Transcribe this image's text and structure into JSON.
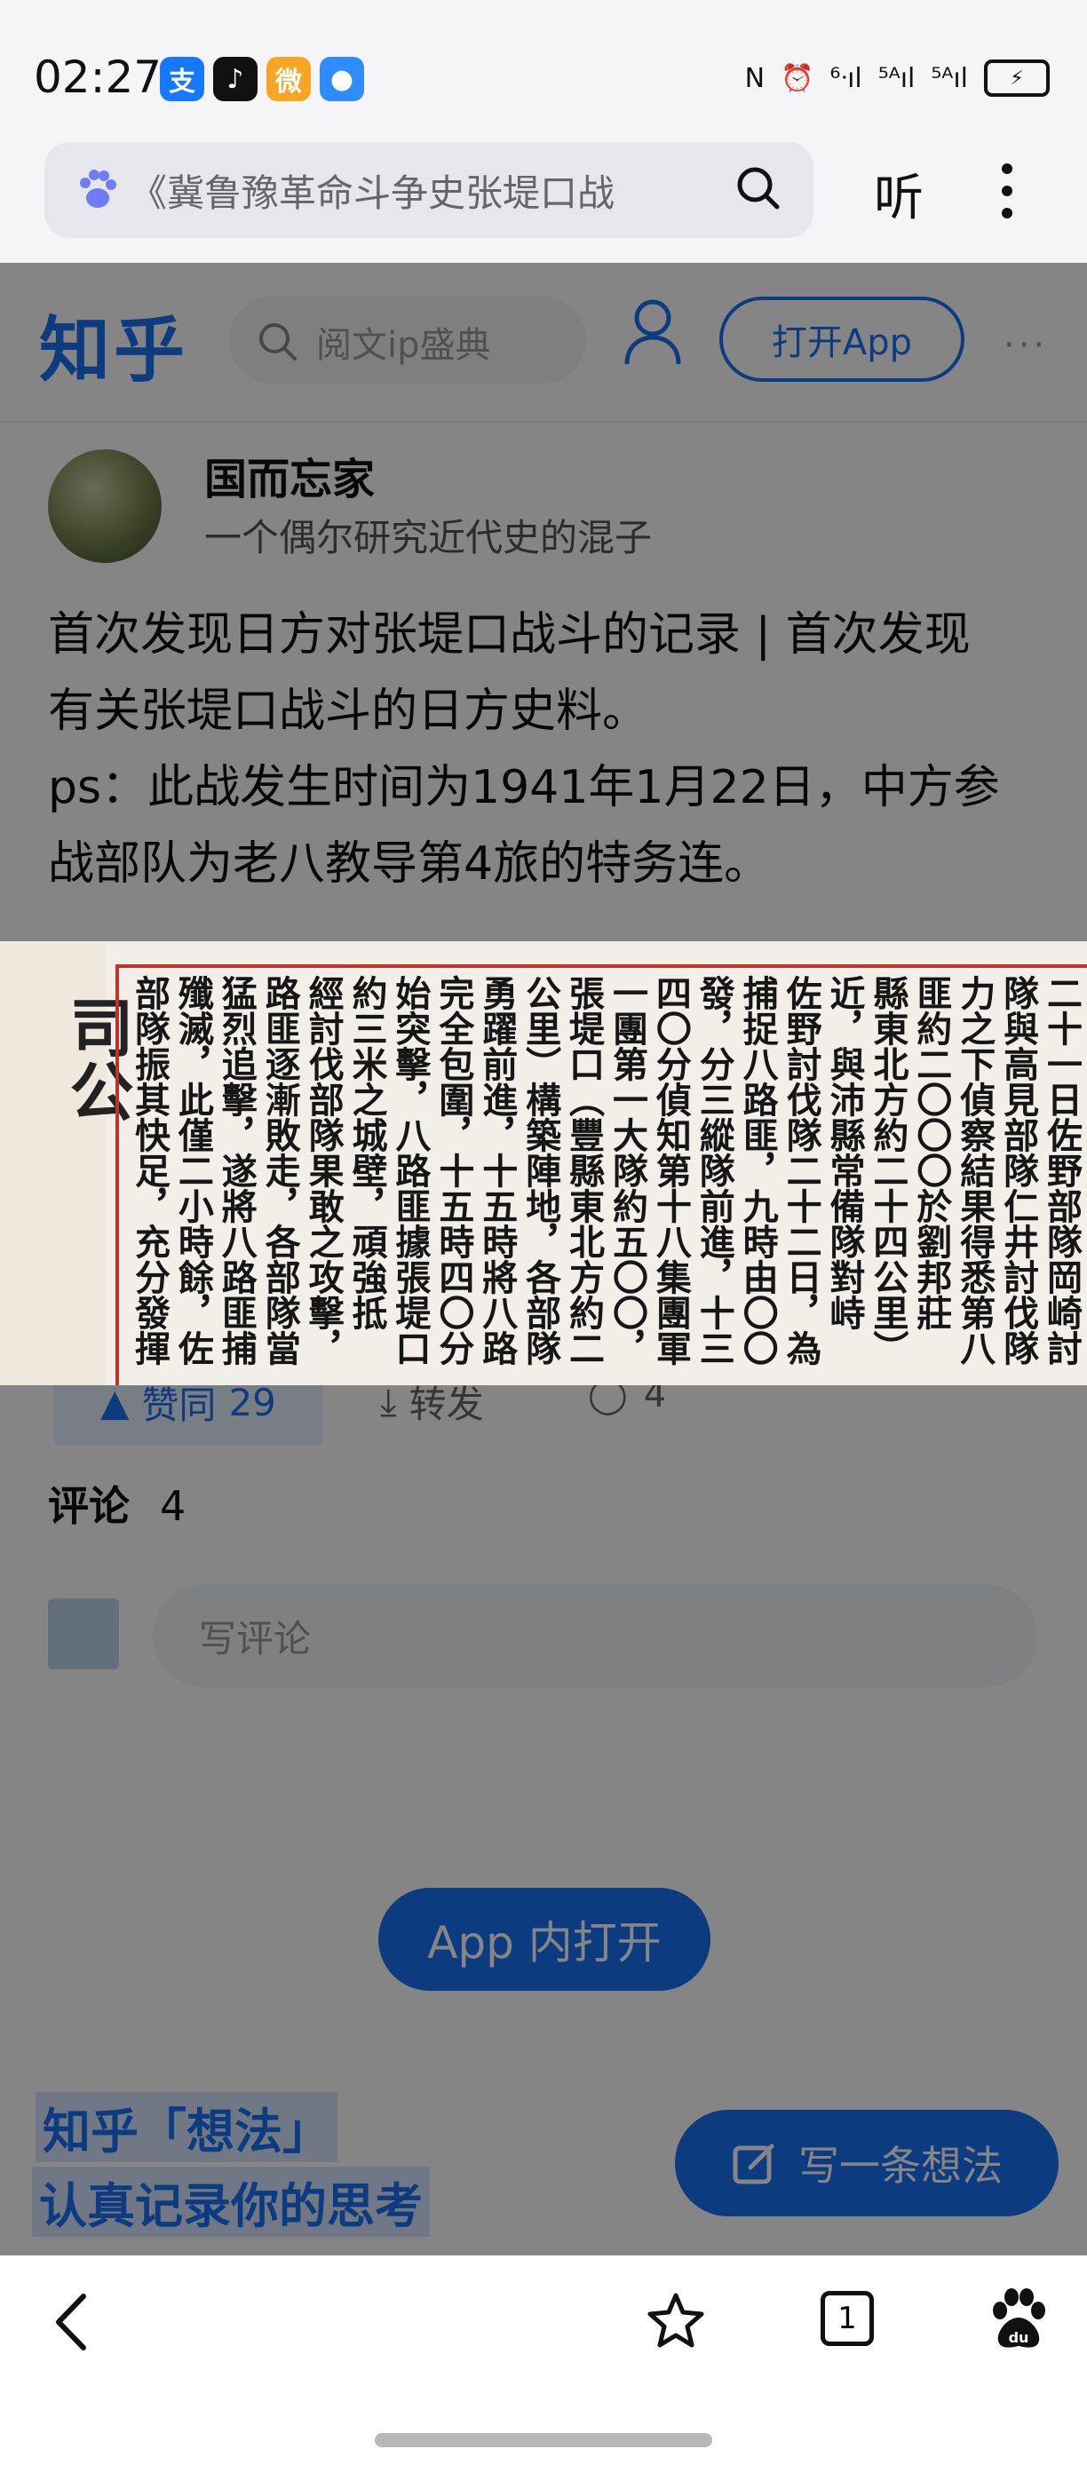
{
  "status_bar": {
    "time": "02:27",
    "app_icons": [
      {
        "name": "alipay-icon",
        "glyph": "支",
        "color": "#1677ff"
      },
      {
        "name": "douyin-icon",
        "glyph": "♪",
        "color": "#111111"
      },
      {
        "name": "weibo-icon",
        "glyph": "微",
        "color": "#f5a623"
      },
      {
        "name": "message-icon",
        "glyph": "●",
        "color": "#2f8cff"
      }
    ],
    "signal_1": "⁶ᐧıl",
    "signal_2": "⁵ᴬıl",
    "signal_3": "⁵ᴬıl",
    "battery_glyph": "⚡"
  },
  "browser": {
    "search_text": "《冀鲁豫革命斗争史张堤口战",
    "listen_label": "听"
  },
  "zhihu": {
    "logo": "知乎",
    "search_placeholder": "阅文ip盛典",
    "open_app_label": "打开App",
    "more_label": "···"
  },
  "post": {
    "author_name": "国而忘家",
    "author_bio": "一个偶尔研究近代史的混子",
    "lines": [
      "首次发现日方对张堤口战斗的记录 | 首次发现",
      "有关张堤口战斗的日方史料。",
      "ps：此战发生时间为1941年1月22日，中方参",
      "战部队为老八教导第4旅的特务连。"
    ],
    "like_label": "赞同",
    "like_count": "29",
    "share_label": "转发",
    "comment_count": "4"
  },
  "comments": {
    "title": "评论",
    "count": "4",
    "input_placeholder": "写评论"
  },
  "promo": {
    "open_in_app": "App  内打开",
    "line1": "知乎「想法」",
    "line2": "认真记录你的思考",
    "write_thought": "写一条想法"
  },
  "newspaper": {
    "left_glyphs": "司公",
    "columns": [
      "二十一日佐野部隊岡崎討伐",
      "隊與高見部隊仁井討伐隊協",
      "力之下偵察結果得悉第八路",
      "匪約二〇〇〇於劉邦莊（豐",
      "縣東北方約二十四公里）附",
      "近，與沛縣常備隊對峙中，",
      "佐野討伐隊二十二日，為期",
      "捕捉八路匪，九時由〇〇出",
      "發，分三縱隊前進，十三時",
      "四〇分偵知第十八集團軍第",
      "一團第一大隊約五〇〇，於",
      "張堤口（豐縣東北方約二十",
      "公里）構築陣地，各部隊當即",
      "勇躍前進，十五時將八路匪",
      "完全包圍，十五時四〇分開",
      "始突擊，八路匪據張堤口高",
      "約三米之城壁，頑強抵抗，",
      "經討伐部隊果敢之攻擊，八",
      "路匪逐漸敗走，各部隊當即",
      "猛烈追擊，遂將八路匪捕捉",
      "殲滅，此僅二小時餘，佐野",
      "部隊振其快足，充分發揮"
    ]
  },
  "bottom_nav": {
    "tab_count": "1"
  }
}
